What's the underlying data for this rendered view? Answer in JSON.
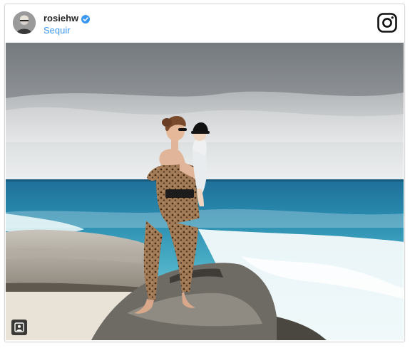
{
  "post": {
    "username": "rosiehw",
    "follow_label": "Sequir",
    "verified": true,
    "accent_color": "#3897f0"
  },
  "icons": {
    "brand": "instagram-logo-icon",
    "verified": "verified-badge-icon",
    "tag": "user-tag-icon"
  },
  "photo": {
    "subject": "beach-photo"
  }
}
